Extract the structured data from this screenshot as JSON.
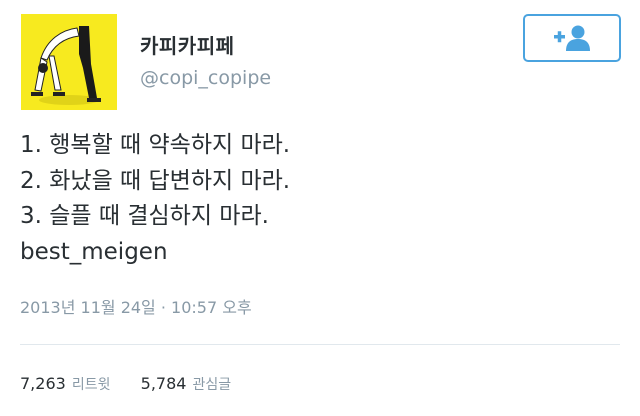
{
  "user": {
    "display_name": "카피카피페",
    "screen_name": "@copi_copipe",
    "avatar_icon": "avatar-image",
    "avatar_bg": "#f7ea1f"
  },
  "follow_button": {
    "icon": "follow-user-icon",
    "border_color": "#4aa3df"
  },
  "tweet": {
    "lines": [
      "1. 행복할 때 약속하지 마라.",
      "2. 화났을 때 답변하지 마라.",
      "3. 슬플 때 결심하지 마라.",
      "best_meigen"
    ],
    "timestamp": "2013년 11월 24일 · 10:57 오후"
  },
  "stats": {
    "retweets_count": "7,263",
    "retweets_label": "리트윗",
    "favorites_count": "5,784",
    "favorites_label": "관심글"
  }
}
